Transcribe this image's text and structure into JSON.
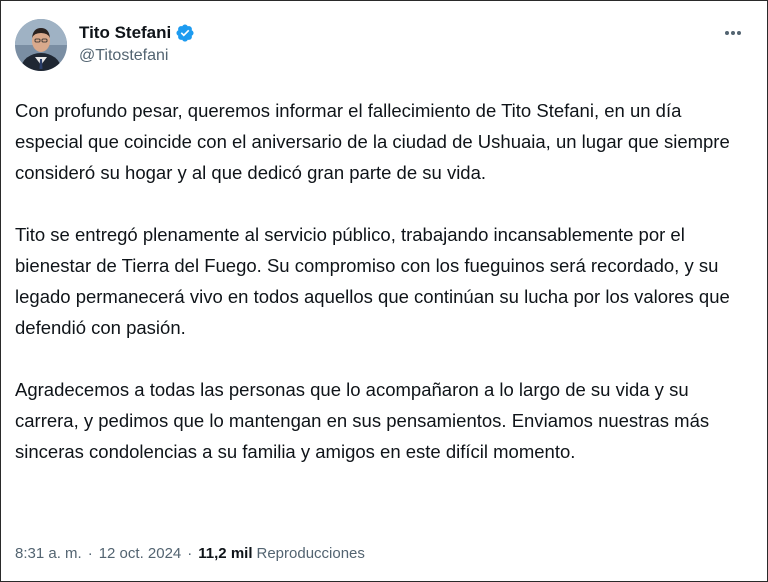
{
  "author": {
    "display_name": "Tito Stefani",
    "handle": "@Titostefani",
    "verified_icon": "verified-badge-icon",
    "verified_color": "#1d9bf0"
  },
  "tweet": {
    "paragraphs": [
      "Con profundo pesar, queremos informar el fallecimiento de Tito Stefani, en un día especial que coincide con el aniversario de la ciudad de Ushuaia, un lugar que siempre consideró su hogar y al que dedicó gran parte de su vida.",
      "Tito se entregó plenamente al servicio público, trabajando incansablemente por el bienestar de Tierra del Fuego. Su compromiso con los fueguinos será recordado, y su legado permanecerá vivo en todos aquellos que continúan su lucha por los valores que defendió con pasión.",
      "Agradecemos a todas las personas que lo acompañaron a lo largo de su vida y su carrera, y pedimos que lo mantengan en sus pensamientos. Enviamos nuestras más sinceras condolencias a su familia y amigos en este difícil momento."
    ]
  },
  "meta": {
    "time": "8:31 a. m.",
    "separator": "·",
    "date": "12 oct. 2024",
    "views_count": "11,2 mil",
    "views_label": "Reproducciones"
  },
  "icons": {
    "more": "more-options-icon",
    "avatar": "avatar"
  },
  "colors": {
    "text_primary": "#0f1419",
    "text_secondary": "#536471",
    "accent": "#1d9bf0"
  }
}
